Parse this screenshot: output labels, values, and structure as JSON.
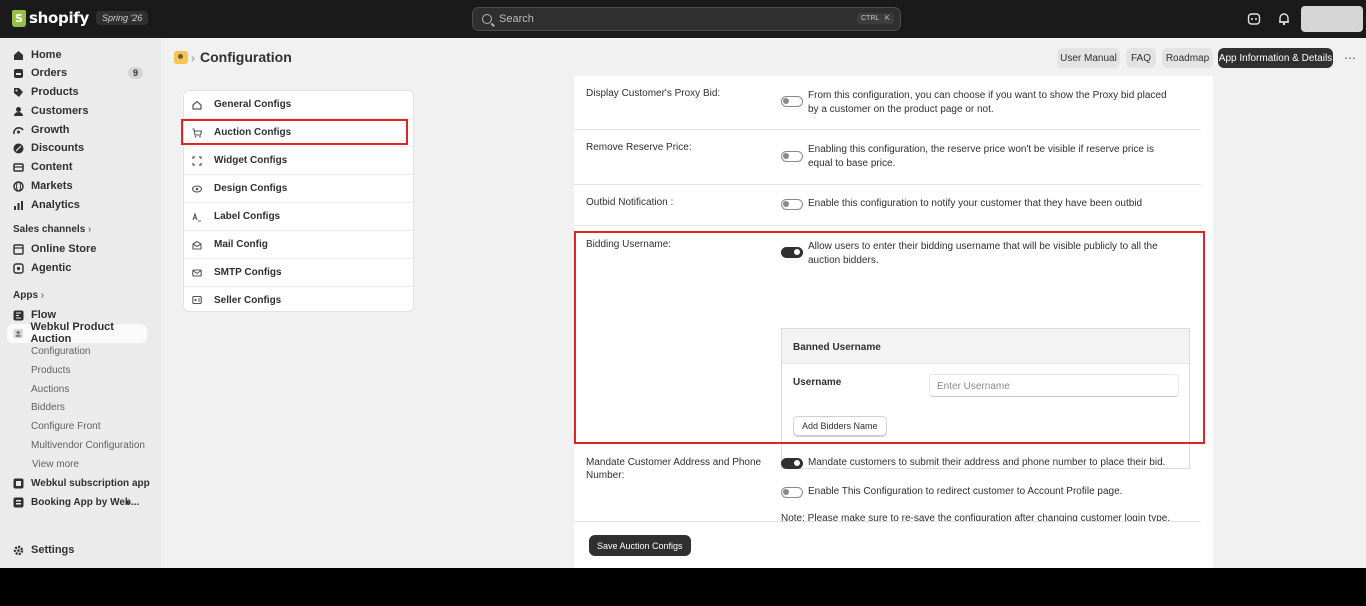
{
  "topbar": {
    "brand": "shopify",
    "edition": "Spring '26",
    "search_placeholder": "Search",
    "shortcut_ctrl": "CTRL",
    "shortcut_k": "K"
  },
  "sidebar": {
    "items": [
      {
        "label": "Home",
        "icon": "home-icon"
      },
      {
        "label": "Orders",
        "icon": "orders-icon",
        "badge": "9"
      },
      {
        "label": "Products",
        "icon": "tag-icon"
      },
      {
        "label": "Customers",
        "icon": "person-icon"
      },
      {
        "label": "Growth",
        "icon": "growth-icon"
      },
      {
        "label": "Discounts",
        "icon": "discount-icon"
      },
      {
        "label": "Content",
        "icon": "content-icon"
      },
      {
        "label": "Markets",
        "icon": "globe-icon"
      },
      {
        "label": "Analytics",
        "icon": "chart-icon"
      }
    ],
    "sales_channels_label": "Sales channels",
    "sales_channels": [
      {
        "label": "Online Store"
      },
      {
        "label": "Agentic"
      }
    ],
    "apps_label": "Apps",
    "apps": [
      {
        "label": "Flow"
      },
      {
        "label": "Webkul Product Auction"
      }
    ],
    "app_subitems": [
      "Configuration",
      "Products",
      "Auctions",
      "Bidders",
      "Configure Front",
      "Multivendor Configuration",
      "View more"
    ],
    "more_apps": [
      "Webkul subscription app",
      "Booking App by Web..."
    ],
    "settings_label": "Settings"
  },
  "header": {
    "title": "Configuration",
    "buttons": [
      "User Manual",
      "FAQ",
      "Roadmap",
      "App Information & Details"
    ]
  },
  "menu": [
    {
      "label": "General Configs"
    },
    {
      "label": "Auction Configs"
    },
    {
      "label": "Widget Configs"
    },
    {
      "label": "Design Configs"
    },
    {
      "label": "Label Configs"
    },
    {
      "label": "Mail Config"
    },
    {
      "label": "SMTP Configs"
    },
    {
      "label": "Seller Configs"
    }
  ],
  "configs": {
    "proxy_bid": {
      "label": "Display Customer's Proxy Bid:",
      "desc": "From this configuration, you can choose if you want to show the Proxy bid placed by a customer on the product page or not.",
      "enabled": false
    },
    "reserve_price": {
      "label": "Remove Reserve Price:",
      "desc": "Enabling this configuration, the reserve price won't be visible if reserve price is equal to base price.",
      "enabled": false
    },
    "outbid": {
      "label": "Outbid Notification :",
      "desc": "Enable this configuration to notify your customer that they have been outbid",
      "enabled": false
    },
    "bidding_username": {
      "label": "Bidding Username:",
      "desc": "Allow users to enter their bidding username that will be visible publicly to all the auction bidders.",
      "enabled": true
    },
    "banned": {
      "title": "Banned Username",
      "username_label": "Username",
      "username_placeholder": "Enter Username",
      "add_button": "Add Bidders Name"
    },
    "mandate_address": {
      "label": "Mandate Customer Address and Phone Number:",
      "desc": "Mandate customers to submit their address and phone number to place their bid.",
      "enabled": true
    },
    "redirect_profile": {
      "desc": "Enable This Configuration to redirect customer to Account Profile page.",
      "enabled": false
    },
    "note": "Note:  Please make sure to re-save the configuration after changing customer login type."
  },
  "save_button": "Save Auction Configs"
}
